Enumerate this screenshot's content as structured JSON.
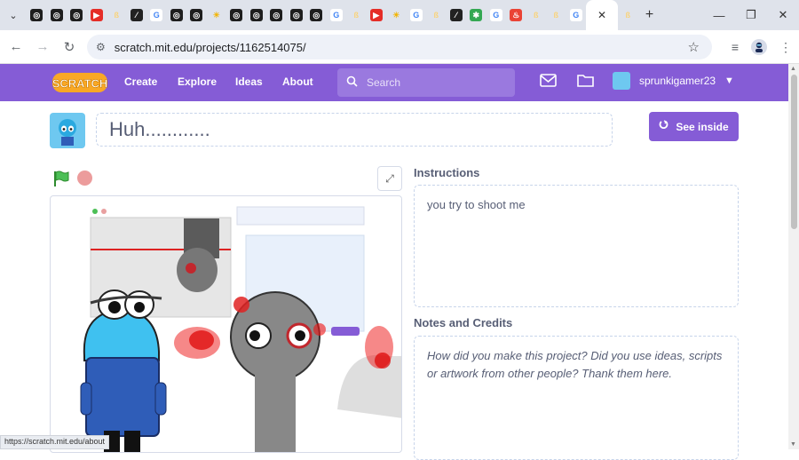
{
  "browser": {
    "tabs": [
      {
        "icon": "target-icon",
        "color": "#1e1e1e"
      },
      {
        "icon": "target-icon",
        "color": "#1e1e1e"
      },
      {
        "icon": "target-icon",
        "color": "#1e1e1e"
      },
      {
        "icon": "youtube-icon",
        "color": "#e52d27"
      },
      {
        "icon": "scratch-cat-icon",
        "color": "#f9d37a"
      },
      {
        "icon": "slash-icon",
        "color": "#222222"
      },
      {
        "icon": "google-icon",
        "color": "#4285f4"
      },
      {
        "icon": "target-icon",
        "color": "#1e1e1e"
      },
      {
        "icon": "target-icon",
        "color": "#1e1e1e"
      },
      {
        "icon": "sun-icon",
        "color": "#f2b400"
      },
      {
        "icon": "target-icon",
        "color": "#1e1e1e"
      },
      {
        "icon": "target-icon",
        "color": "#1e1e1e"
      },
      {
        "icon": "target-icon",
        "color": "#1e1e1e"
      },
      {
        "icon": "target-icon",
        "color": "#1e1e1e"
      },
      {
        "icon": "target-icon",
        "color": "#1e1e1e"
      },
      {
        "icon": "google-icon",
        "color": "#4285f4"
      },
      {
        "icon": "scratch-cat-icon",
        "color": "#f9d37a"
      },
      {
        "icon": "youtube-icon",
        "color": "#e52d27"
      },
      {
        "icon": "sun-icon",
        "color": "#f2b400"
      },
      {
        "icon": "google-icon",
        "color": "#4285f4"
      },
      {
        "icon": "scratch-cat-icon",
        "color": "#f9d37a"
      },
      {
        "icon": "slash-icon",
        "color": "#222222"
      },
      {
        "icon": "pinwheel-icon",
        "color": "#34a853"
      },
      {
        "icon": "google-icon",
        "color": "#4285f4"
      },
      {
        "icon": "fire-icon",
        "color": "#ea4335"
      },
      {
        "icon": "scratch-cat-icon",
        "color": "#f9d37a"
      },
      {
        "icon": "scratch-cat-icon",
        "color": "#f9d37a"
      },
      {
        "icon": "google-icon",
        "color": "#4285f4"
      }
    ],
    "url": "scratch.mit.edu/projects/1162514075/",
    "status_url": "https://scratch.mit.edu/about"
  },
  "nav": {
    "links": [
      "Create",
      "Explore",
      "Ideas",
      "About"
    ],
    "search_placeholder": "Search",
    "username": "sprunkigamer23",
    "brand_color": "#855cd6"
  },
  "project": {
    "title": "Huh............",
    "see_inside": "See inside",
    "instructions_label": "Instructions",
    "instructions": "you try to shoot me",
    "notes_label": "Notes and Credits",
    "notes_placeholder": "How did you make this project? Did you use ideas, scripts or artwork from other people? Thank them here."
  }
}
